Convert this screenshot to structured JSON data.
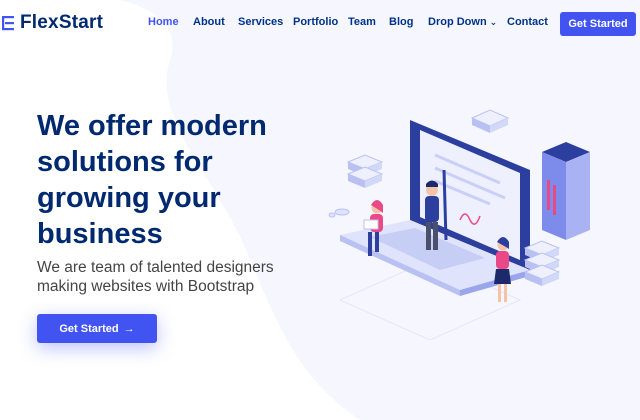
{
  "brand": {
    "name": "FlexStart",
    "color": "#012970",
    "accent": "#4154f1"
  },
  "nav": {
    "items": [
      {
        "label": "Home",
        "active": true
      },
      {
        "label": "About"
      },
      {
        "label": "Services"
      },
      {
        "label": "Portfolio"
      },
      {
        "label": "Team"
      },
      {
        "label": "Blog"
      },
      {
        "label": "Drop Down",
        "icon": "chevron-down-icon"
      },
      {
        "label": "Contact"
      }
    ],
    "cta": "Get Started"
  },
  "hero": {
    "title": "We offer modern solutions for growing your business",
    "subtitle": "We are team of talented designers making websites with Bootstrap",
    "button": "Get Started",
    "button_icon": "arrow-right-icon"
  }
}
